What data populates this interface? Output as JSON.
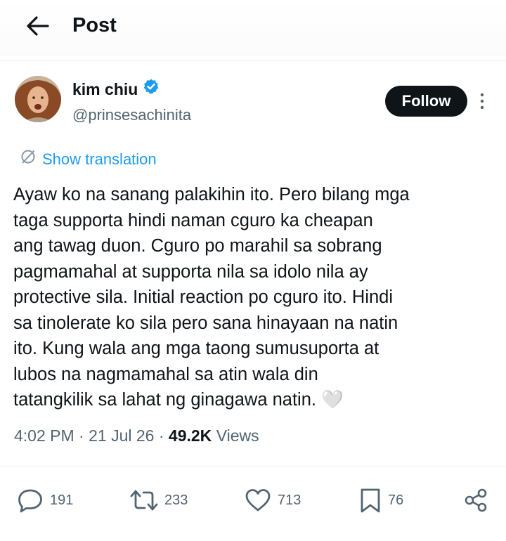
{
  "header": {
    "title": "Post"
  },
  "author": {
    "name": "kim chiu",
    "handle": "@prinsesachinita",
    "verified_color": "#1d9bf0"
  },
  "follow_label": "Follow",
  "translate_label": "Show translation",
  "post": {
    "text": "Ayaw ko na sanang palakihin ito. Pero bilang mga\ntaga supporta hindi naman cguro ka cheapan\nang tawag duon. Cguro po marahil sa sobrang\npagmamahal at supporta nila sa idolo nila ay\nprotective sila. Initial reaction po cguro ito. Hindi\nsa tinolerate ko sila pero sana hinayaan na natin\nito.  Kung wala ang mga taong sumusuporta at\nlubos na nagmamahal sa atin wala din\ntatangkilik sa lahat ng ginagawa natin. 🤍",
    "time": "4:02 PM",
    "date": "21 Jul 26",
    "views_count": "49.2K",
    "views_label": "Views"
  },
  "actions": {
    "replies": "191",
    "reposts": "233",
    "likes": "713",
    "bookmarks": "76"
  },
  "colors": {
    "accent": "#1d9bf0",
    "text": "#0f1419",
    "secondary": "#536471"
  }
}
